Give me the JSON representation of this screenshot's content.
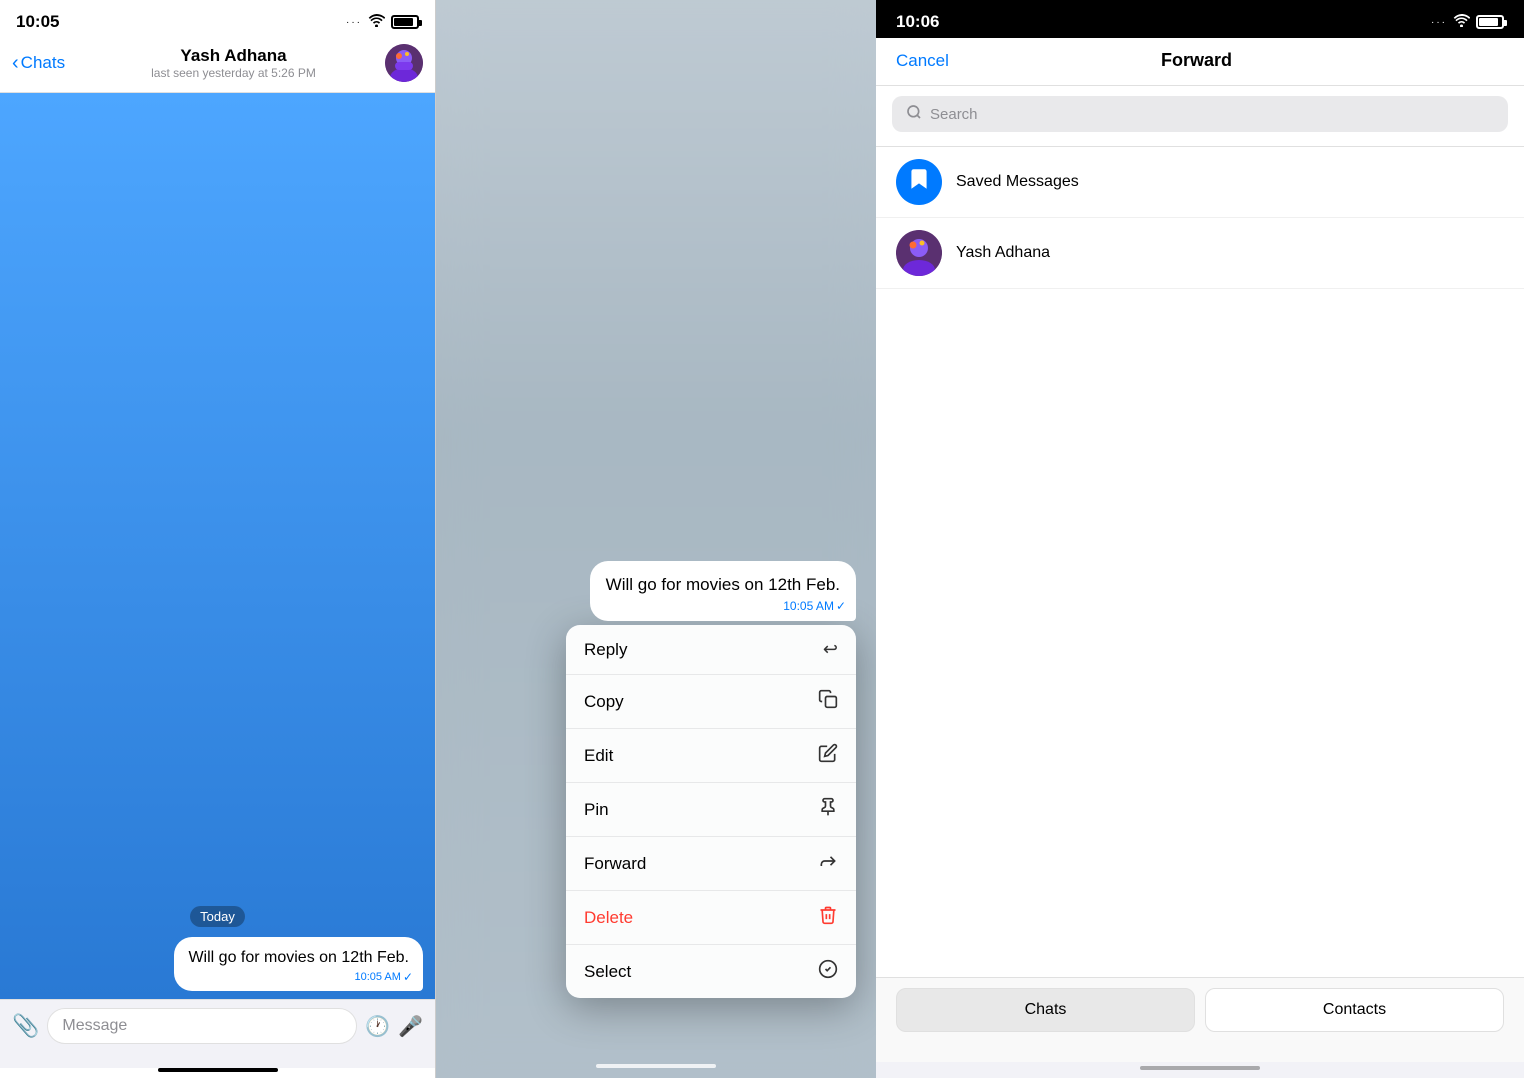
{
  "panel1": {
    "statusBar": {
      "time": "10:05"
    },
    "navBar": {
      "backLabel": "Chats",
      "contactName": "Yash Adhana",
      "contactStatus": "last seen yesterday at 5:26 PM"
    },
    "chat": {
      "dateBadge": "Today",
      "messageBubble": "Will go for movies on 12th Feb.",
      "messageTime": "10:05 AM",
      "checkmark": "✓"
    },
    "inputBar": {
      "placeholder": "Message"
    }
  },
  "panel2": {
    "messageBubble": "Will go for movies on 12th Feb.",
    "messageTime": "10:05 AM",
    "checkmark": "✓",
    "contextMenu": [
      {
        "label": "Reply",
        "icon": "↩"
      },
      {
        "label": "Copy",
        "icon": "⧉"
      },
      {
        "label": "Edit",
        "icon": "✎"
      },
      {
        "label": "Pin",
        "icon": "⚑"
      },
      {
        "label": "Forward",
        "icon": "↪"
      },
      {
        "label": "Delete",
        "icon": "🗑",
        "isDelete": true
      },
      {
        "label": "Select",
        "icon": "⊙"
      }
    ]
  },
  "panel3": {
    "statusBar": {
      "time": "10:06"
    },
    "navBar": {
      "cancelLabel": "Cancel",
      "title": "Forward"
    },
    "searchBar": {
      "placeholder": "Search"
    },
    "contacts": [
      {
        "id": "saved-messages",
        "name": "Saved Messages",
        "type": "saved"
      },
      {
        "id": "yash-adhana",
        "name": "Yash Adhana",
        "type": "yash"
      }
    ],
    "bottomTabs": [
      {
        "id": "chats",
        "label": "Chats",
        "active": true
      },
      {
        "id": "contacts",
        "label": "Contacts",
        "active": false
      }
    ]
  }
}
